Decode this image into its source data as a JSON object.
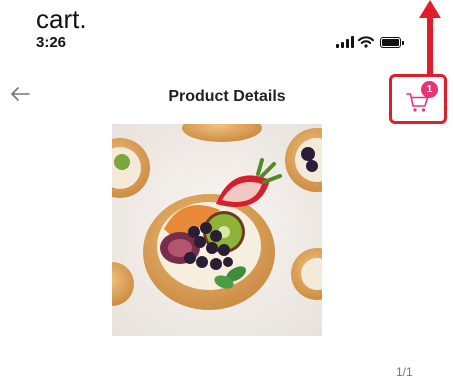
{
  "caption": "cart.",
  "status_bar": {
    "time": "3:26"
  },
  "header": {
    "title": "Product Details"
  },
  "cart": {
    "badge_count": "1"
  },
  "gallery": {
    "counter": "1/1"
  },
  "colors": {
    "highlight": "#e11d2c",
    "cart_accent": "#e8337a"
  },
  "icons": [
    "signal-icon",
    "wifi-icon",
    "battery-icon",
    "up-arrow-icon",
    "back-arrow-icon",
    "cart-icon"
  ]
}
